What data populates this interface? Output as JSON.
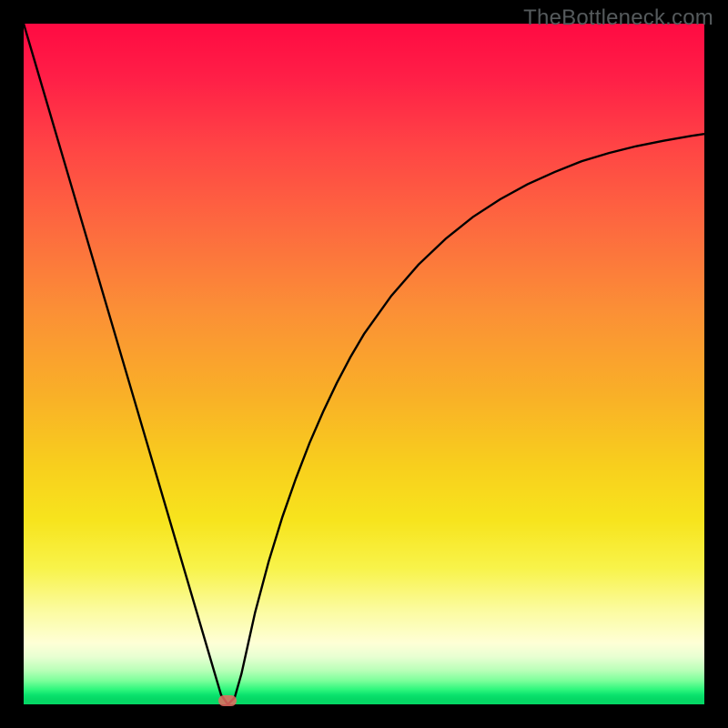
{
  "watermark": "TheBottleneck.com",
  "chart_data": {
    "type": "line",
    "title": "",
    "xlabel": "",
    "ylabel": "",
    "xlim": [
      0,
      100
    ],
    "ylim": [
      0,
      100
    ],
    "x": [
      0,
      2,
      4,
      6,
      8,
      10,
      12,
      14,
      16,
      18,
      20,
      22,
      24,
      26,
      28,
      29,
      30,
      31,
      32,
      33,
      34,
      36,
      38,
      40,
      42,
      44,
      46,
      48,
      50,
      54,
      58,
      62,
      66,
      70,
      74,
      78,
      82,
      86,
      90,
      94,
      98,
      100
    ],
    "values": [
      100,
      93.2,
      86.4,
      79.6,
      72.8,
      66.0,
      59.2,
      52.4,
      45.6,
      38.8,
      32.0,
      25.2,
      18.4,
      11.6,
      4.8,
      1.4,
      0.0,
      1.0,
      4.5,
      9.0,
      13.5,
      21.0,
      27.5,
      33.2,
      38.4,
      43.0,
      47.2,
      51.0,
      54.4,
      60.0,
      64.6,
      68.4,
      71.6,
      74.2,
      76.4,
      78.2,
      79.8,
      81.0,
      82.0,
      82.8,
      83.5,
      83.8
    ],
    "marker": {
      "x": 30,
      "y": 0
    },
    "background_gradient": {
      "orientation": "vertical",
      "stops": [
        {
          "pos": 0.0,
          "color": "#ff0a42"
        },
        {
          "pos": 0.3,
          "color": "#fd6a3f"
        },
        {
          "pos": 0.55,
          "color": "#f9b127"
        },
        {
          "pos": 0.8,
          "color": "#f8f34a"
        },
        {
          "pos": 0.92,
          "color": "#fefedf"
        },
        {
          "pos": 0.97,
          "color": "#7dff9b"
        },
        {
          "pos": 1.0,
          "color": "#05d865"
        }
      ]
    }
  }
}
